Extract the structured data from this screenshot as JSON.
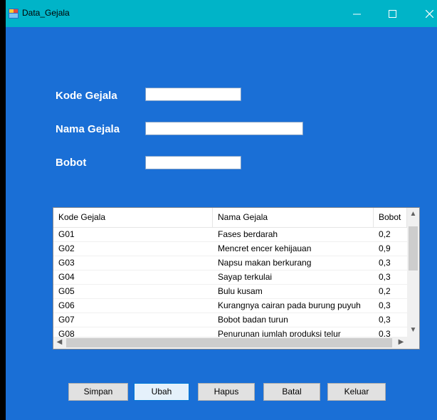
{
  "window": {
    "title": "Data_Gejala"
  },
  "form": {
    "kode_label": "Kode Gejala",
    "nama_label": "Nama Gejala",
    "bobot_label": "Bobot",
    "kode_value": "",
    "nama_value": "",
    "bobot_value": ""
  },
  "grid": {
    "columns": [
      "Kode Gejala",
      "Nama Gejala",
      "Bobot"
    ],
    "rows": [
      [
        "G01",
        "Fases berdarah",
        "0,2"
      ],
      [
        "G02",
        "Mencret encer kehijauan",
        "0,9"
      ],
      [
        "G03",
        "Napsu makan berkurang",
        "0,3"
      ],
      [
        "G04",
        "Sayap terkulai",
        "0,3"
      ],
      [
        "G05",
        "Bulu kusam",
        "0,2"
      ],
      [
        "G06",
        "Kurangnya cairan pada burung puyuh",
        "0,3"
      ],
      [
        "G07",
        "Bobot badan turun",
        "0,3"
      ],
      [
        "G08",
        "Penurunan jumlah produksi telur",
        "0,3"
      ]
    ]
  },
  "buttons": {
    "simpan": "Simpan",
    "ubah": "Ubah",
    "hapus": "Hapus",
    "batal": "Batal",
    "keluar": "Keluar"
  },
  "colors": {
    "form_bg": "#1a6fd6",
    "titlebar": "#00b4c8"
  },
  "icons": [
    "app-icon",
    "minimize-icon",
    "maximize-icon",
    "close-icon",
    "scroll-up-icon",
    "scroll-down-icon",
    "scroll-left-icon",
    "scroll-right-icon"
  ]
}
